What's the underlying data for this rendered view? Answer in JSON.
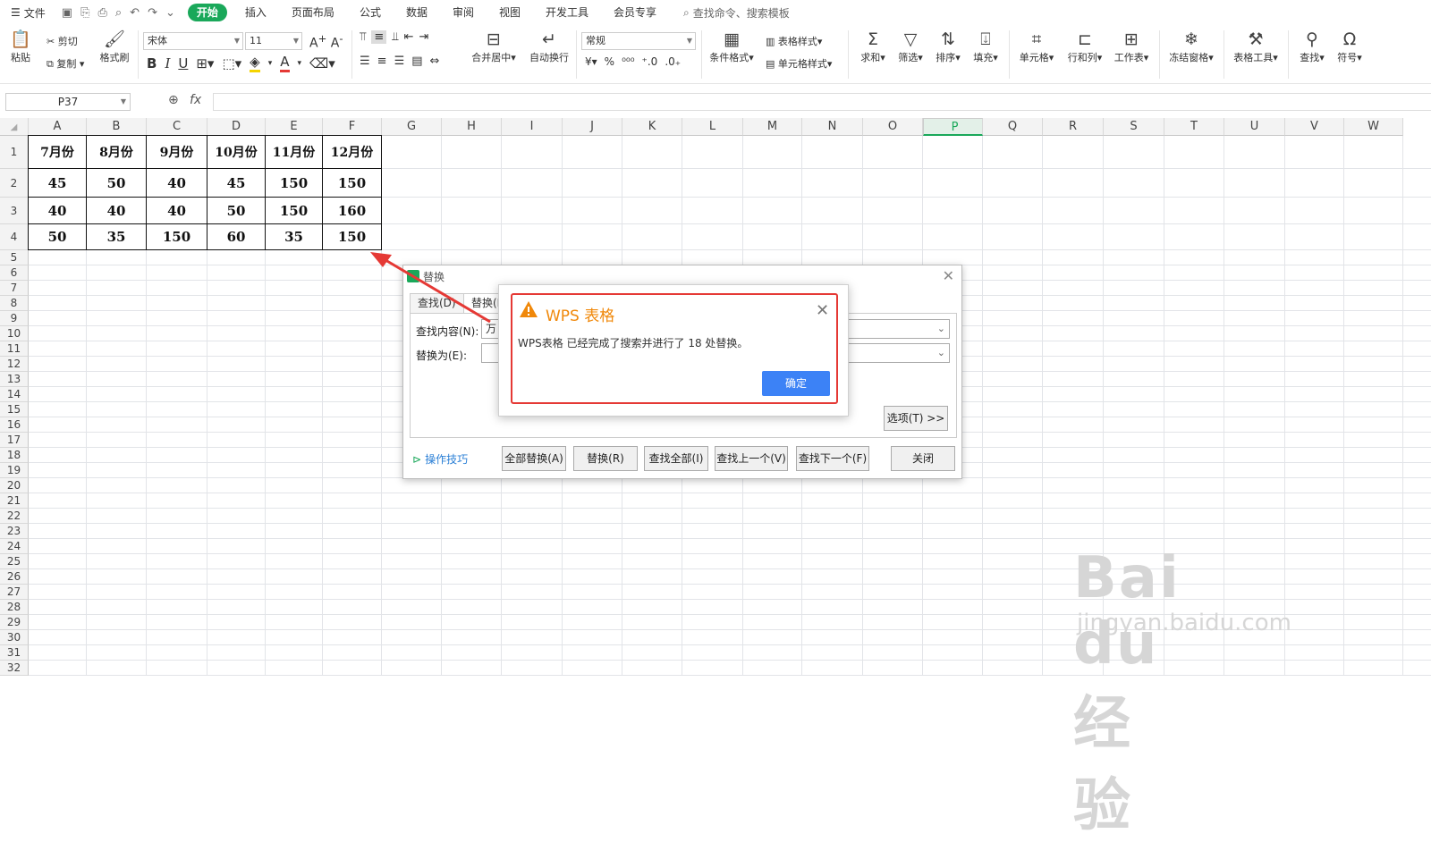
{
  "menubar": {
    "file_label": "文件",
    "tabs": [
      "开始",
      "插入",
      "页面布局",
      "公式",
      "数据",
      "审阅",
      "视图",
      "开发工具",
      "会员专享"
    ],
    "search_placeholder": "查找命令、搜索模板"
  },
  "ribbon": {
    "paste": "粘贴",
    "cut": "剪切",
    "copy": "复制",
    "format_painter": "格式刷",
    "font_name": "宋体",
    "font_size": "11",
    "merge_center": "合并居中",
    "wrap_text": "自动换行",
    "number_format": "常规",
    "conditional_format": "条件格式",
    "table_style": "表格样式",
    "cell_style": "单元格样式",
    "sum": "求和",
    "filter": "筛选",
    "sort": "排序",
    "fill": "填充",
    "cell": "单元格",
    "row_col": "行和列",
    "worksheet": "工作表",
    "freeze": "冻结窗格",
    "table_tools": "表格工具",
    "find": "查找",
    "symbol": "符号"
  },
  "formula_bar": {
    "name_box": "P37",
    "fx": "fx",
    "value": ""
  },
  "columns": [
    "A",
    "B",
    "C",
    "D",
    "E",
    "F",
    "G",
    "H",
    "I",
    "J",
    "K",
    "L",
    "M",
    "N",
    "O",
    "P",
    "Q",
    "R",
    "S",
    "T",
    "U",
    "V",
    "W"
  ],
  "selected_column": "P",
  "rows": [
    1,
    2,
    3,
    4,
    5,
    6,
    7,
    8,
    9,
    10,
    11,
    12,
    13,
    14,
    15,
    16,
    17,
    18,
    19,
    20,
    21,
    22,
    23,
    24,
    25,
    26,
    27,
    28,
    29,
    30,
    31,
    32
  ],
  "table": [
    [
      "7月份",
      "8月份",
      "9月份",
      "10月份",
      "11月份",
      "12月份"
    ],
    [
      "45",
      "50",
      "40",
      "45",
      "150",
      "150"
    ],
    [
      "40",
      "40",
      "40",
      "50",
      "150",
      "160"
    ],
    [
      "50",
      "35",
      "150",
      "60",
      "35",
      "150"
    ]
  ],
  "replace_dialog": {
    "title": "替换",
    "tab_find": "查找(D)",
    "tab_replace": "替换(P)",
    "find_label": "查找内容(N):",
    "find_value": "万",
    "replace_label": "替换为(E):",
    "replace_value": "",
    "options_button": "选项(T) >>",
    "tips": "操作技巧",
    "buttons": [
      "全部替换(A)",
      "替换(R)",
      "查找全部(I)",
      "查找上一个(V)",
      "查找下一个(F)",
      "关闭"
    ]
  },
  "alert": {
    "title": "WPS 表格",
    "message": "WPS表格 已经完成了搜索并进行了 18 处替换。",
    "ok": "确定"
  },
  "watermark": {
    "brand": "Bai du 经验",
    "url": "jingyan.baidu.com"
  },
  "colors": {
    "accent": "#1aa85a",
    "highlight": "#e53935",
    "ok_button": "#3c82f6",
    "warning": "#f0880a"
  }
}
